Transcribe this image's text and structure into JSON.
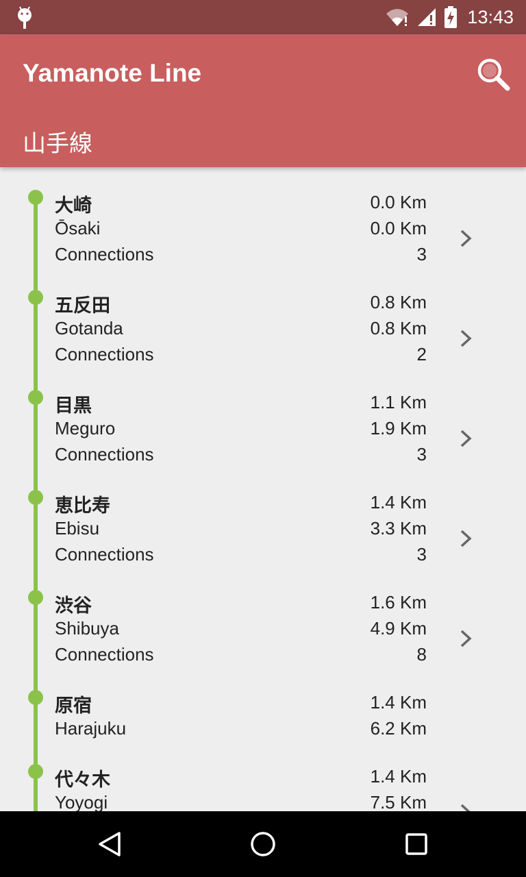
{
  "status_bar": {
    "time": "13:43"
  },
  "app_bar": {
    "title": "Yamanote Line",
    "subtitle": "山手線"
  },
  "accent_color": "#8bc34a",
  "toolbar_color": "#c85e5e",
  "stations": [
    {
      "kanji": "大崎",
      "romaji": "Ōsaki",
      "segment_km": "0.0 Km",
      "total_km": "0.0 Km",
      "connections_label": "Connections",
      "connections": "3"
    },
    {
      "kanji": "五反田",
      "romaji": "Gotanda",
      "segment_km": "0.8 Km",
      "total_km": "0.8 Km",
      "connections_label": "Connections",
      "connections": "2"
    },
    {
      "kanji": "目黒",
      "romaji": "Meguro",
      "segment_km": "1.1 Km",
      "total_km": "1.9 Km",
      "connections_label": "Connections",
      "connections": "3"
    },
    {
      "kanji": "恵比寿",
      "romaji": "Ebisu",
      "segment_km": "1.4 Km",
      "total_km": "3.3 Km",
      "connections_label": "Connections",
      "connections": "3"
    },
    {
      "kanji": "渋谷",
      "romaji": "Shibuya",
      "segment_km": "1.6 Km",
      "total_km": "4.9 Km",
      "connections_label": "Connections",
      "connections": "8"
    },
    {
      "kanji": "原宿",
      "romaji": "Harajuku",
      "segment_km": "1.4 Km",
      "total_km": "6.2 Km"
    },
    {
      "kanji": "代々木",
      "romaji": "Yoyogi",
      "segment_km": "1.4 Km",
      "total_km": "7.5 Km"
    }
  ]
}
